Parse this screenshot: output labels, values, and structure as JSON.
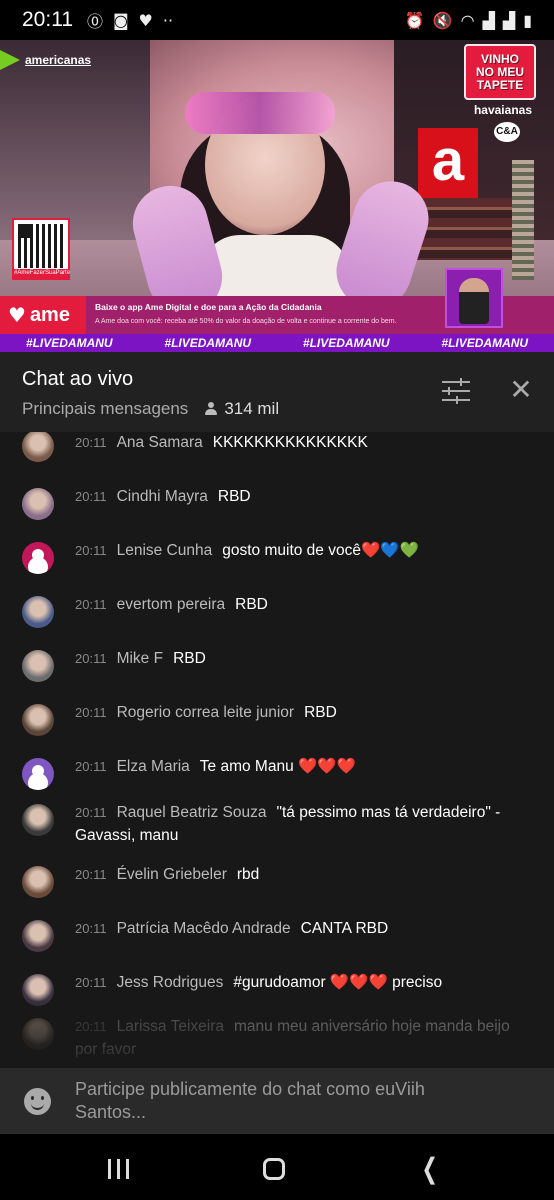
{
  "status_bar": {
    "time": "20:11",
    "left_icons": [
      "data-saver-icon",
      "instagram-icon",
      "heart-icon",
      "more-dots-icon"
    ],
    "right_icons": [
      "alarm-icon",
      "mute-icon",
      "wifi-icon",
      "signal-icon",
      "signal-icon",
      "battery-icon"
    ]
  },
  "video": {
    "americanas_label": "americanas",
    "vinho_lines": [
      "VINHO",
      "NO MEU",
      "TAPETE"
    ],
    "havaianas_label": "havaianas",
    "ca_logo": "C&A",
    "big_letter": "a",
    "qr_caption": "#AmeFazerSuaParte",
    "ame_word": "ame",
    "ame_heart": "♥",
    "promo_line1": "Baixe o app Ame Digital e doe para a Ação da Cidadania",
    "promo_line2": "A Ame doa com você: receba até 50% do valor da doação de volta e continue a corrente do bem.",
    "hashtags": [
      "#LIVEDAMANU",
      "#LIVEDAMANU",
      "#LIVEDAMANU",
      "#LIVEDAMANU"
    ]
  },
  "chat_header": {
    "title": "Chat ao vivo",
    "filter_label": "Principais mensagens",
    "viewers": "314 mil",
    "close_glyph": "✕"
  },
  "messages": [
    {
      "time": "20:11",
      "author": "Ana Samara",
      "text": "KKKKKKKKKKKKKKK",
      "avatar_color": "#7a5a4a",
      "default": false
    },
    {
      "time": "20:11",
      "author": "Cindhi Mayra",
      "text": "RBD",
      "avatar_color": "#8b6f8a",
      "default": false
    },
    {
      "time": "20:11",
      "author": "Lenise Cunha",
      "text": "gosto muito de você❤️💙💚",
      "avatar_color": "#c2185b",
      "default": true
    },
    {
      "time": "20:11",
      "author": "evertom pereira",
      "text": "RBD",
      "avatar_color": "#4a5a8a",
      "default": false
    },
    {
      "time": "20:11",
      "author": "Mike F",
      "text": "RBD",
      "avatar_color": "#6d6d6d",
      "default": false
    },
    {
      "time": "20:11",
      "author": "Rogerio correa leite junior",
      "text": "RBD",
      "avatar_color": "#5a4538",
      "default": false
    },
    {
      "time": "20:11",
      "author": "Elza Maria",
      "text": "Te amo Manu ❤️❤️❤️",
      "avatar_color": "#7e57c2",
      "default": true
    },
    {
      "time": "20:11",
      "author": "Raquel Beatriz Souza",
      "text": "\"tá pessimo mas tá verdadeiro\" - Gavassi, manu",
      "avatar_color": "#3a3a3a",
      "default": false
    },
    {
      "time": "20:11",
      "author": "Évelin Griebeler",
      "text": "rbd",
      "avatar_color": "#6a4a3a",
      "default": false
    },
    {
      "time": "20:11",
      "author": "Patrícia Macêdo Andrade",
      "text": "CANTA RBD",
      "avatar_color": "#4a3a44",
      "default": false
    },
    {
      "time": "20:11",
      "author": "Jess Rodrigues",
      "text": "#gurudoamor ❤️❤️❤️ preciso",
      "avatar_color": "#3a3040",
      "default": false
    },
    {
      "time": "20:11",
      "author": "Larissa Teixeira",
      "text": "manu meu aniversário hoje manda beijo por favor",
      "avatar_color": "#5a4a40",
      "default": false
    }
  ],
  "input": {
    "placeholder": "Participe publicamente do chat como euViih Santos..."
  },
  "nav_bar": {
    "icons": [
      "recent-apps-icon",
      "home-icon",
      "back-icon"
    ],
    "back_glyph": "❮"
  }
}
